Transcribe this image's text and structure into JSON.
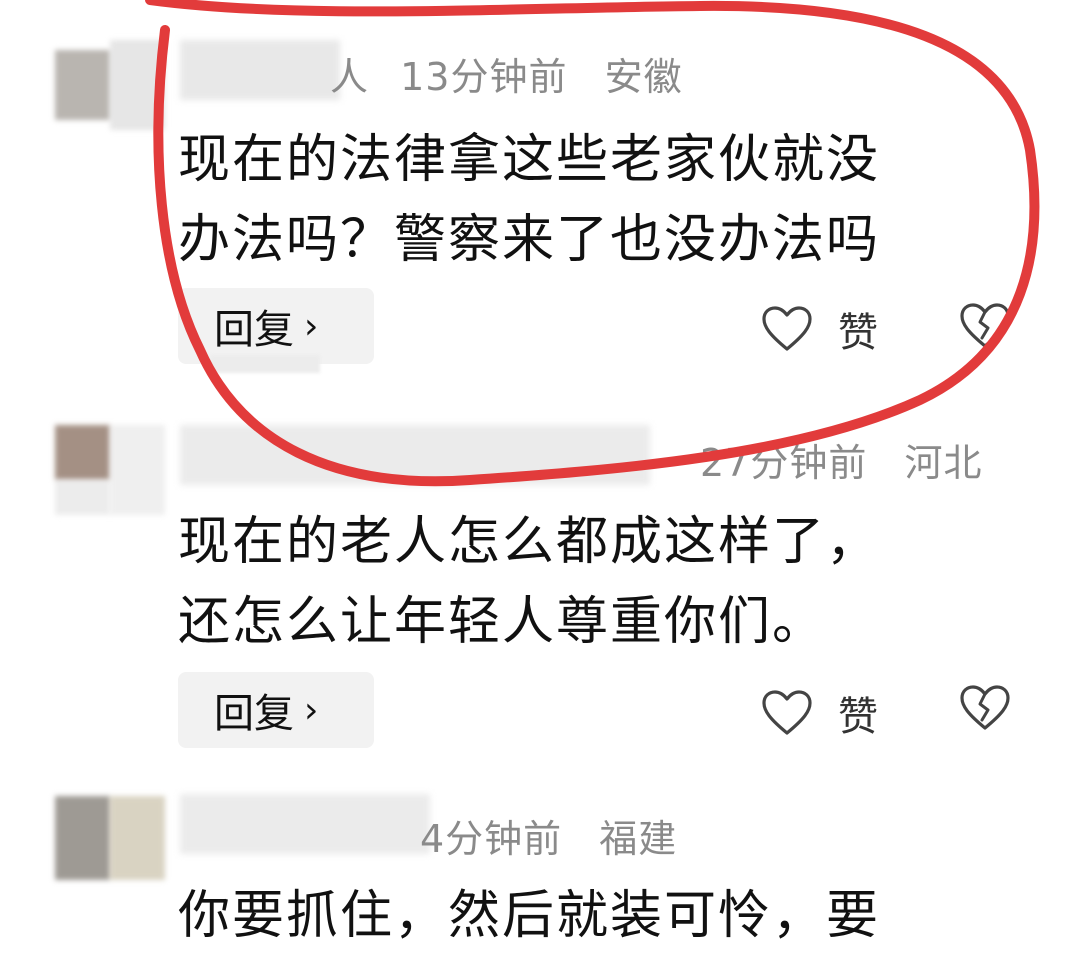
{
  "colors": {
    "annotation": "#e23b3b",
    "meta": "#8a8a8a",
    "text": "#111111",
    "reply_bg": "#f2f2f2"
  },
  "comments": [
    {
      "time": "13分钟前",
      "location": "安徽",
      "meta_prefix": "人",
      "lines": [
        "现在的法律拿这些老家伙就没",
        "办法吗？警察来了也没办法吗"
      ],
      "reply_label": "回复",
      "reply_chevron": "›",
      "like_label": "赞",
      "like_icon": "heart-outline-icon",
      "dislike_icon": "broken-heart-icon"
    },
    {
      "time": "27分钟前",
      "location": "河北",
      "lines": [
        "现在的老人怎么都成这样了，",
        "还怎么让年轻人尊重你们。"
      ],
      "reply_label": "回复",
      "reply_chevron": "›",
      "like_label": "赞",
      "like_icon": "heart-outline-icon",
      "dislike_icon": "broken-heart-icon"
    },
    {
      "time": "4分钟前",
      "location": "福建",
      "lines": [
        "你要抓住，然后就装可怜，要"
      ]
    }
  ]
}
